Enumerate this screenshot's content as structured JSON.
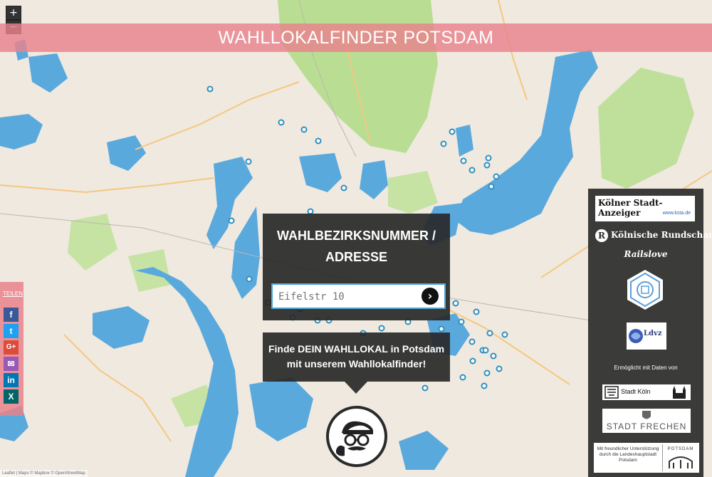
{
  "map": {
    "zoom_in": "+",
    "zoom_out": "−",
    "marker_color": "#2f8fbf",
    "water_color": "#5aa9dd",
    "forest_color": "#b5dc8d",
    "attribution": "Leaflet | Maps © Mapbox © OpenStreetMap"
  },
  "header": {
    "title": "WAHLLOKALFINDER POTSDAM"
  },
  "search": {
    "title_line1": "WAHLBEZIRKSNUMMER /",
    "title_line2": "ADRESSE",
    "placeholder": "Eifelstr 10",
    "submit_icon": "chevron-right-icon"
  },
  "tip": {
    "line1": "Finde DEIN WAHLLOKAL in Potsdam",
    "line2": "mit unserem Wahllokalfinder!"
  },
  "share": {
    "label": "TEILEN",
    "buttons": [
      {
        "icon": "facebook-icon",
        "glyph": "f",
        "color": "#3b5998"
      },
      {
        "icon": "twitter-icon",
        "glyph": "t",
        "color": "#1da1f2"
      },
      {
        "icon": "google-plus-icon",
        "glyph": "G+",
        "color": "#dd4b39"
      },
      {
        "icon": "mail-icon",
        "glyph": "✉",
        "color": "#9b59b6"
      },
      {
        "icon": "linkedin-icon",
        "glyph": "in",
        "color": "#0077b5"
      },
      {
        "icon": "xing-icon",
        "glyph": "X",
        "color": "#026466"
      }
    ]
  },
  "sponsors": {
    "ksta_name": "Kölner Stadt-Anzeiger",
    "ksta_url": "www.ksta.de",
    "kr_letter": "R",
    "kr_name": "Kölnische Rundschau",
    "railslove": "Railslove",
    "ldvz": "Ldvz",
    "made_possible": "Ermöglicht mit Daten von",
    "koeln": "Stadt Köln",
    "frechen": "STADT FRECHEN",
    "potsdam_text": "Mit freundlicher Unterstützung durch die Landeshauptstadt Potsdam",
    "potsdam_logo": "POTSDAM"
  }
}
